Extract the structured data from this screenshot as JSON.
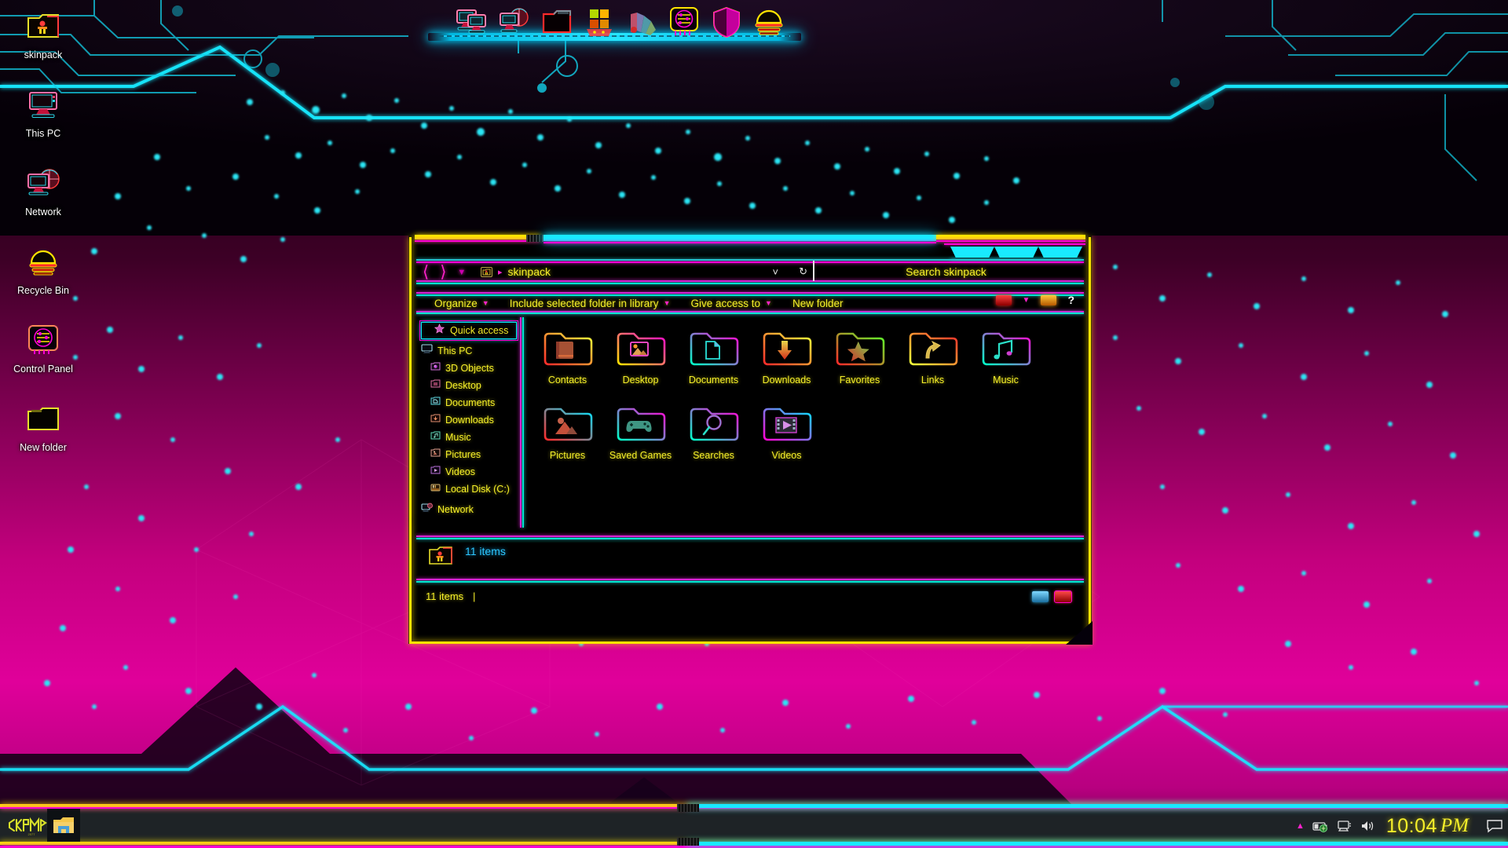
{
  "desktop": {
    "icons": [
      {
        "label": "skinpack",
        "icon": "skinpack-folder-icon"
      },
      {
        "label": "This PC",
        "icon": "this-pc-icon"
      },
      {
        "label": "Network",
        "icon": "network-icon"
      },
      {
        "label": "Recycle Bin",
        "icon": "recycle-bin-icon"
      },
      {
        "label": "Control Panel",
        "icon": "control-panel-icon"
      },
      {
        "label": "New folder",
        "icon": "folder-icon"
      }
    ]
  },
  "dock": {
    "items": [
      {
        "name": "displays-icon"
      },
      {
        "name": "network-globe-icon"
      },
      {
        "name": "folder-icon"
      },
      {
        "name": "windows-start-icon"
      },
      {
        "name": "color-fan-icon"
      },
      {
        "name": "settings-sliders-icon"
      },
      {
        "name": "shield-icon"
      },
      {
        "name": "recycle-bin-icon"
      }
    ]
  },
  "explorer": {
    "title": "skinpack",
    "nav": {
      "back_icon": "back-chevron-icon",
      "forward_icon": "forward-chevron-icon",
      "recent_icon": "recent-locations-caret-icon",
      "up_icon": "up-caret-icon"
    },
    "address": {
      "folder_icon": "address-folder-icon",
      "separator": "▸",
      "path": "skinpack",
      "dropdown_icon": "chevron-down-icon",
      "refresh_icon": "refresh-icon"
    },
    "search": {
      "placeholder": "Search skinpack"
    },
    "commandbar": {
      "items": [
        {
          "label": "Organize",
          "has_dropdown": true
        },
        {
          "label": "Include selected folder in library",
          "has_dropdown": true
        },
        {
          "label": "Give access to",
          "has_dropdown": true
        },
        {
          "label": "New folder",
          "has_dropdown": false
        }
      ],
      "view_button": "change-view-button",
      "view_dropdown": "view-dropdown-icon",
      "preview_button": "preview-pane-button",
      "help_button": "?"
    },
    "sidebar": {
      "quick_access": {
        "label": "Quick access",
        "icon": "star-icon",
        "selected": true
      },
      "items": [
        {
          "label": "This PC",
          "icon": "this-pc-icon",
          "indent": 0
        },
        {
          "label": "3D Objects",
          "icon": "3d-objects-icon",
          "indent": 1
        },
        {
          "label": "Desktop",
          "icon": "desktop-icon",
          "indent": 1
        },
        {
          "label": "Documents",
          "icon": "documents-icon",
          "indent": 1
        },
        {
          "label": "Downloads",
          "icon": "downloads-icon",
          "indent": 1
        },
        {
          "label": "Music",
          "icon": "music-icon",
          "indent": 1
        },
        {
          "label": "Pictures",
          "icon": "pictures-icon",
          "indent": 1
        },
        {
          "label": "Videos",
          "icon": "videos-icon",
          "indent": 1
        },
        {
          "label": "Local Disk (C:)",
          "icon": "local-disk-icon",
          "indent": 1
        },
        {
          "label": "Network",
          "icon": "network-icon",
          "indent": 0
        }
      ]
    },
    "files": [
      {
        "label": "Contacts",
        "icon": "contacts-folder-icon",
        "edge_from": "#ff2a2a",
        "edge_to": "#f2ff3a",
        "inner": "contacts"
      },
      {
        "label": "Desktop",
        "icon": "desktop-folder-icon",
        "edge_from": "#ffe400",
        "edge_to": "#ff00d4",
        "inner": "picture"
      },
      {
        "label": "Documents",
        "icon": "documents-folder-icon",
        "edge_from": "#00ffc8",
        "edge_to": "#ff00d4",
        "inner": "document"
      },
      {
        "label": "Downloads",
        "icon": "downloads-folder-icon",
        "edge_from": "#ff2a2a",
        "edge_to": "#f2ff3a",
        "inner": "download"
      },
      {
        "label": "Favorites",
        "icon": "favorites-folder-icon",
        "edge_from": "#ff2a2a",
        "edge_to": "#55ff2a",
        "inner": "star"
      },
      {
        "label": "Links",
        "icon": "links-folder-icon",
        "edge_from": "#f2ff3a",
        "edge_to": "#ff2a2a",
        "inner": "link"
      },
      {
        "label": "Music",
        "icon": "music-folder-icon",
        "edge_from": "#00ffc8",
        "edge_to": "#ff00d4",
        "inner": "music"
      },
      {
        "label": "Pictures",
        "icon": "pictures-folder-icon",
        "edge_from": "#ff2a2a",
        "edge_to": "#00e5ff",
        "inner": "picture2"
      },
      {
        "label": "Saved Games",
        "icon": "saved-games-folder-icon",
        "edge_from": "#00ffc8",
        "edge_to": "#ff00d4",
        "inner": "gamepad"
      },
      {
        "label": "Searches",
        "icon": "searches-folder-icon",
        "edge_from": "#00ffc8",
        "edge_to": "#ff00d4",
        "inner": "search"
      },
      {
        "label": "Videos",
        "icon": "videos-folder-icon",
        "edge_from": "#ff00d4",
        "edge_to": "#00e5ff",
        "inner": "film"
      }
    ],
    "details": {
      "icon": "skinpack-folder-icon",
      "item_count": "11 items"
    },
    "statusbar": {
      "item_count": "11 items",
      "separator": "|",
      "view_icons": [
        "details-view-icon",
        "large-icons-view-icon"
      ]
    },
    "window_buttons": [
      {
        "name": "minimize-button"
      },
      {
        "name": "maximize-button"
      },
      {
        "name": "close-button"
      }
    ]
  },
  "taskbar": {
    "logo": "cyberpunk-logo",
    "items": [
      {
        "name": "file-explorer-taskbar-button"
      }
    ],
    "tray": {
      "overflow_icon": "show-hidden-icons-icon",
      "icons": [
        "battery-icon",
        "network-icon",
        "volume-icon"
      ],
      "time": "10:04",
      "meridiem": "PM",
      "notification_icon": "notification-center-icon"
    }
  },
  "colors": {
    "cyan": "#18e9ff",
    "magenta": "#ff00d4",
    "yellow": "#ffe400",
    "pink_bg": "#d9008f",
    "dark": "#04000a"
  }
}
